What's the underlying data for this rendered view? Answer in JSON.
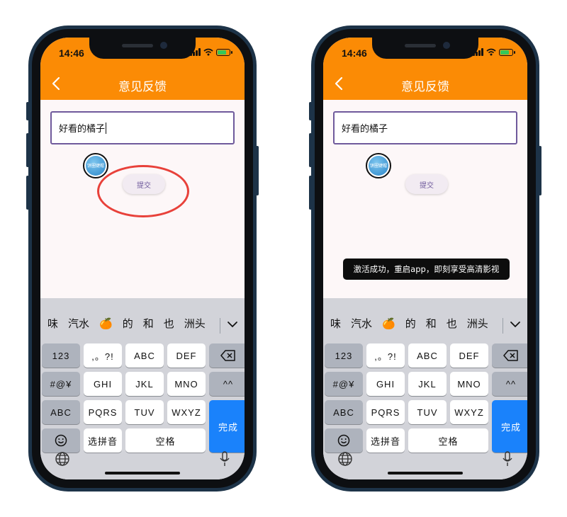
{
  "status": {
    "time": "14:46"
  },
  "header": {
    "title": "意见反馈"
  },
  "left": {
    "input_value": "好看的橘子"
  },
  "right": {
    "input_value": "好看的橘子",
    "toast": "激活成功，重启app，即刻享受高清影视"
  },
  "badge": {
    "line1": "饼圈",
    "line2": "键帽"
  },
  "submit_label": "提交",
  "candidates": [
    "味",
    "汽水",
    "🍊",
    "的",
    "和",
    "也",
    "洲头"
  ],
  "keys": {
    "num": "123",
    "punct": ",。?!",
    "abc": "ABC",
    "def": "DEF",
    "sym": "#@¥",
    "ghi": "GHI",
    "jkl": "JKL",
    "mno": "MNO",
    "face": "^^",
    "abc_mode": "ABC",
    "pqrs": "PQRS",
    "tuv": "TUV",
    "wxyz": "WXYZ",
    "done": "完成",
    "pinyin": "选拼音",
    "space": "空格"
  },
  "colors": {
    "header": "#fb8b05",
    "done_key": "#1a82fb",
    "annotation": "#e8413a",
    "input_border": "#6f5a9c"
  }
}
